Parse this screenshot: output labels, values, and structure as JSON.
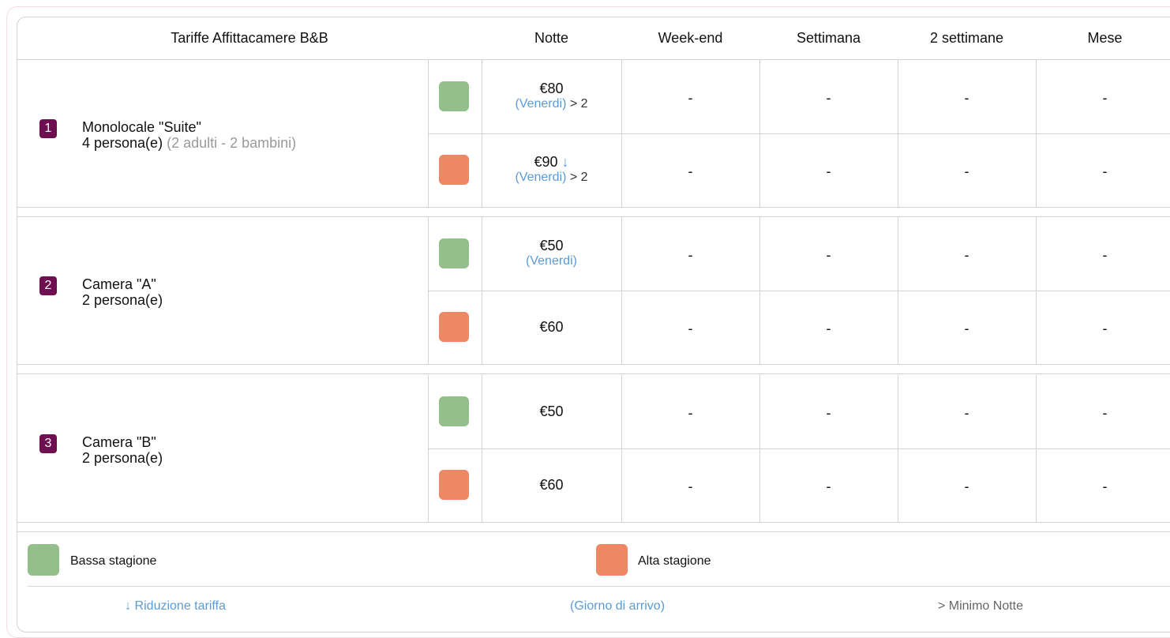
{
  "colors": {
    "low_season": "#93c08a",
    "high_season": "#ee8763",
    "badge": "#6e0f4f",
    "link_blue": "#5b9bd5"
  },
  "header": {
    "title": "Tariffe Affittacamere B&B",
    "cols": [
      "Notte",
      "Week-end",
      "Settimana",
      "2 settimane",
      "Mese"
    ]
  },
  "rooms": [
    {
      "num": "1",
      "name": "Monolocale \"Suite\"",
      "persons": "4 persona(e)",
      "detail": "(2 adulti - 2 bambini)",
      "rows": [
        {
          "season": "low",
          "price": "€80",
          "arrow": "",
          "day": "(Venerdi)",
          "min": "> 2",
          "others": [
            "-",
            "-",
            "-",
            "-"
          ]
        },
        {
          "season": "high",
          "price": "€90",
          "arrow": "↓",
          "day": "(Venerdi)",
          "min": "> 2",
          "others": [
            "-",
            "-",
            "-",
            "-"
          ]
        }
      ]
    },
    {
      "num": "2",
      "name": "Camera \"A\"",
      "persons": "2 persona(e)",
      "detail": "",
      "rows": [
        {
          "season": "low",
          "price": "€50",
          "arrow": "",
          "day": "(Venerdi)",
          "min": "",
          "others": [
            "-",
            "-",
            "-",
            "-"
          ]
        },
        {
          "season": "high",
          "price": "€60",
          "arrow": "",
          "day": "",
          "min": "",
          "others": [
            "-",
            "-",
            "-",
            "-"
          ]
        }
      ]
    },
    {
      "num": "3",
      "name": "Camera \"B\"",
      "persons": "2 persona(e)",
      "detail": "",
      "rows": [
        {
          "season": "low",
          "price": "€50",
          "arrow": "",
          "day": "",
          "min": "",
          "others": [
            "-",
            "-",
            "-",
            "-"
          ]
        },
        {
          "season": "high",
          "price": "€60",
          "arrow": "",
          "day": "",
          "min": "",
          "others": [
            "-",
            "-",
            "-",
            "-"
          ]
        }
      ]
    }
  ],
  "legend": {
    "low_label": "Bassa stagione",
    "high_label": "Alta stagione"
  },
  "footer": {
    "reduction": "↓ Riduzione tariffa",
    "arrival": "(Giorno di arrivo)",
    "min_nights": "> Minimo Notte"
  }
}
